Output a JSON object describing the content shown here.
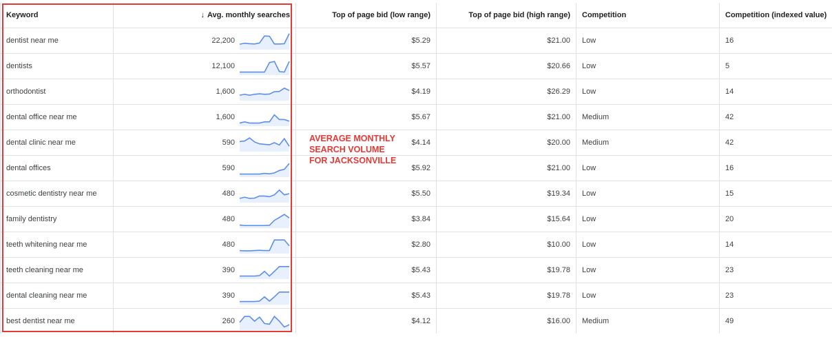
{
  "table": {
    "headers": {
      "keyword": "Keyword",
      "avg": "Avg. monthly searches",
      "low": "Top of page bid (low range)",
      "high": "Top of page bid (high range)",
      "competition": "Competition",
      "indexed": "Competition (indexed value)"
    },
    "rows": [
      {
        "keyword": "dentist near me",
        "avg": "22,200",
        "low": "$5.29",
        "high": "$21.00",
        "competition": "Low",
        "indexed": "16",
        "trend": [
          3,
          3.4,
          3.2,
          3.1,
          3.5,
          6.5,
          6.4,
          3.1,
          3.1,
          3.2,
          7.5
        ]
      },
      {
        "keyword": "dentists",
        "avg": "12,100",
        "low": "$5.57",
        "high": "$20.66",
        "competition": "Low",
        "indexed": "5",
        "trend": [
          2,
          2,
          2,
          2,
          2,
          2,
          6,
          6.5,
          2.2,
          2,
          6.5
        ]
      },
      {
        "keyword": "orthodontist",
        "avg": "1,600",
        "low": "$4.19",
        "high": "$26.29",
        "competition": "Low",
        "indexed": "14",
        "trend": [
          3,
          3.4,
          3,
          3.4,
          3.6,
          3.4,
          3.5,
          4.5,
          4.6,
          6,
          5
        ]
      },
      {
        "keyword": "dental office near me",
        "avg": "1,600",
        "low": "$5.67",
        "high": "$21.00",
        "competition": "Medium",
        "indexed": "42",
        "trend": [
          2,
          2.5,
          2,
          2,
          2,
          2.5,
          2.5,
          5.5,
          3.5,
          3.5,
          2.8
        ]
      },
      {
        "keyword": "dental clinic near me",
        "avg": "590",
        "low": "$4.14",
        "high": "$20.00",
        "competition": "Medium",
        "indexed": "42",
        "trend": [
          5,
          5.2,
          6.5,
          4.8,
          4,
          3.8,
          3.6,
          4.5,
          3.5,
          6.2,
          3
        ]
      },
      {
        "keyword": "dental offices",
        "avg": "590",
        "low": "$5.92",
        "high": "$21.00",
        "competition": "Low",
        "indexed": "16",
        "trend": [
          2,
          2,
          2,
          2,
          2,
          2.3,
          2.1,
          2.5,
          3.5,
          4,
          6.5
        ]
      },
      {
        "keyword": "cosmetic dentistry near me",
        "avg": "480",
        "low": "$5.50",
        "high": "$19.34",
        "competition": "Low",
        "indexed": "15",
        "trend": [
          2.5,
          3,
          2.5,
          2.6,
          3.5,
          3.5,
          3.2,
          4,
          6,
          4,
          4.5
        ]
      },
      {
        "keyword": "family dentistry",
        "avg": "480",
        "low": "$3.84",
        "high": "$15.64",
        "competition": "Low",
        "indexed": "20",
        "trend": [
          2,
          1.8,
          1.8,
          1.8,
          1.8,
          1.8,
          1.9,
          4,
          5.2,
          6.5,
          5
        ]
      },
      {
        "keyword": "teeth whitening near me",
        "avg": "480",
        "low": "$2.80",
        "high": "$10.00",
        "competition": "Low",
        "indexed": "14",
        "trend": [
          2,
          1.9,
          1.9,
          2,
          2.1,
          2,
          2,
          6.5,
          6.5,
          6.5,
          4
        ]
      },
      {
        "keyword": "teeth cleaning near me",
        "avg": "390",
        "low": "$5.43",
        "high": "$19.78",
        "competition": "Low",
        "indexed": "23",
        "trend": [
          2,
          2,
          2,
          2,
          2.2,
          4,
          2,
          4,
          6,
          6,
          6
        ]
      },
      {
        "keyword": "dental cleaning near me",
        "avg": "390",
        "low": "$5.43",
        "high": "$19.78",
        "competition": "Low",
        "indexed": "23",
        "trend": [
          2,
          2,
          2,
          2,
          2.2,
          4,
          2.2,
          4,
          6,
          6,
          6
        ]
      },
      {
        "keyword": "best dentist near me",
        "avg": "260",
        "low": "$4.12",
        "high": "$16.00",
        "competition": "Medium",
        "indexed": "49",
        "trend": [
          4,
          6.5,
          6.5,
          4.5,
          6.2,
          3.5,
          3.2,
          6.5,
          4.5,
          2,
          3
        ]
      }
    ]
  },
  "annotation": {
    "lines": [
      "AVERAGE MONTHLY",
      "SEARCH VOLUME",
      "FOR JACKSONVILLE"
    ],
    "color": "#e53935"
  },
  "colors": {
    "sparkline": "#5b8def",
    "sparkfill": "#e8f0fe"
  },
  "icons": {
    "sort": "arrow-down-icon"
  }
}
